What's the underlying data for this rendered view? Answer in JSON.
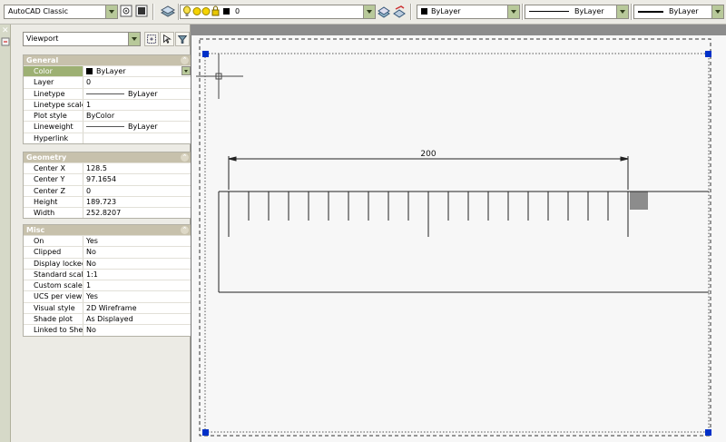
{
  "toolbar": {
    "workspace": "AutoCAD Classic",
    "layer_value": "0",
    "color_value": "ByLayer",
    "linetype_value": "ByLayer",
    "lineweight_value": "ByLayer"
  },
  "palette": {
    "selection": "Viewport",
    "sections": {
      "general": {
        "title": "General",
        "rows": [
          {
            "name": "Color",
            "value": "ByLayer"
          },
          {
            "name": "Layer",
            "value": "0"
          },
          {
            "name": "Linetype",
            "value": "ByLayer"
          },
          {
            "name": "Linetype scale",
            "value": "1"
          },
          {
            "name": "Plot style",
            "value": "ByColor"
          },
          {
            "name": "Lineweight",
            "value": "ByLayer"
          },
          {
            "name": "Hyperlink",
            "value": ""
          }
        ]
      },
      "geometry": {
        "title": "Geometry",
        "rows": [
          {
            "name": "Center X",
            "value": "128.5"
          },
          {
            "name": "Center Y",
            "value": "97.1654"
          },
          {
            "name": "Center Z",
            "value": "0"
          },
          {
            "name": "Height",
            "value": "189.723"
          },
          {
            "name": "Width",
            "value": "252.8207"
          }
        ]
      },
      "misc": {
        "title": "Misc",
        "rows": [
          {
            "name": "On",
            "value": "Yes"
          },
          {
            "name": "Clipped",
            "value": "No"
          },
          {
            "name": "Display locked",
            "value": "No"
          },
          {
            "name": "Standard scale",
            "value": "1:1"
          },
          {
            "name": "Custom scale",
            "value": "1"
          },
          {
            "name": "UCS per viewport",
            "value": "Yes"
          },
          {
            "name": "Visual style",
            "value": "2D Wireframe"
          },
          {
            "name": "Shade plot",
            "value": "As Displayed"
          },
          {
            "name": "Linked to Sheet…",
            "value": "No"
          }
        ]
      }
    }
  },
  "drawing": {
    "dimension_text": "200"
  },
  "icons": {
    "toolbar": [
      "workspace-settings-icon",
      "workspace-props-icon",
      "layer-manager-icon",
      "lightbulb-icon",
      "sun-icon",
      "lock-icon",
      "layer-previous-icon",
      "make-current-icon"
    ],
    "palette": [
      "quick-select-icon",
      "select-objects-icon",
      "toggle-pickadd-icon"
    ]
  },
  "colors": {
    "accent_green": "#b8c99a",
    "selected_row": "#9db073",
    "section_header": "#c7c1ac",
    "viewport_grip": "#0030c8"
  }
}
